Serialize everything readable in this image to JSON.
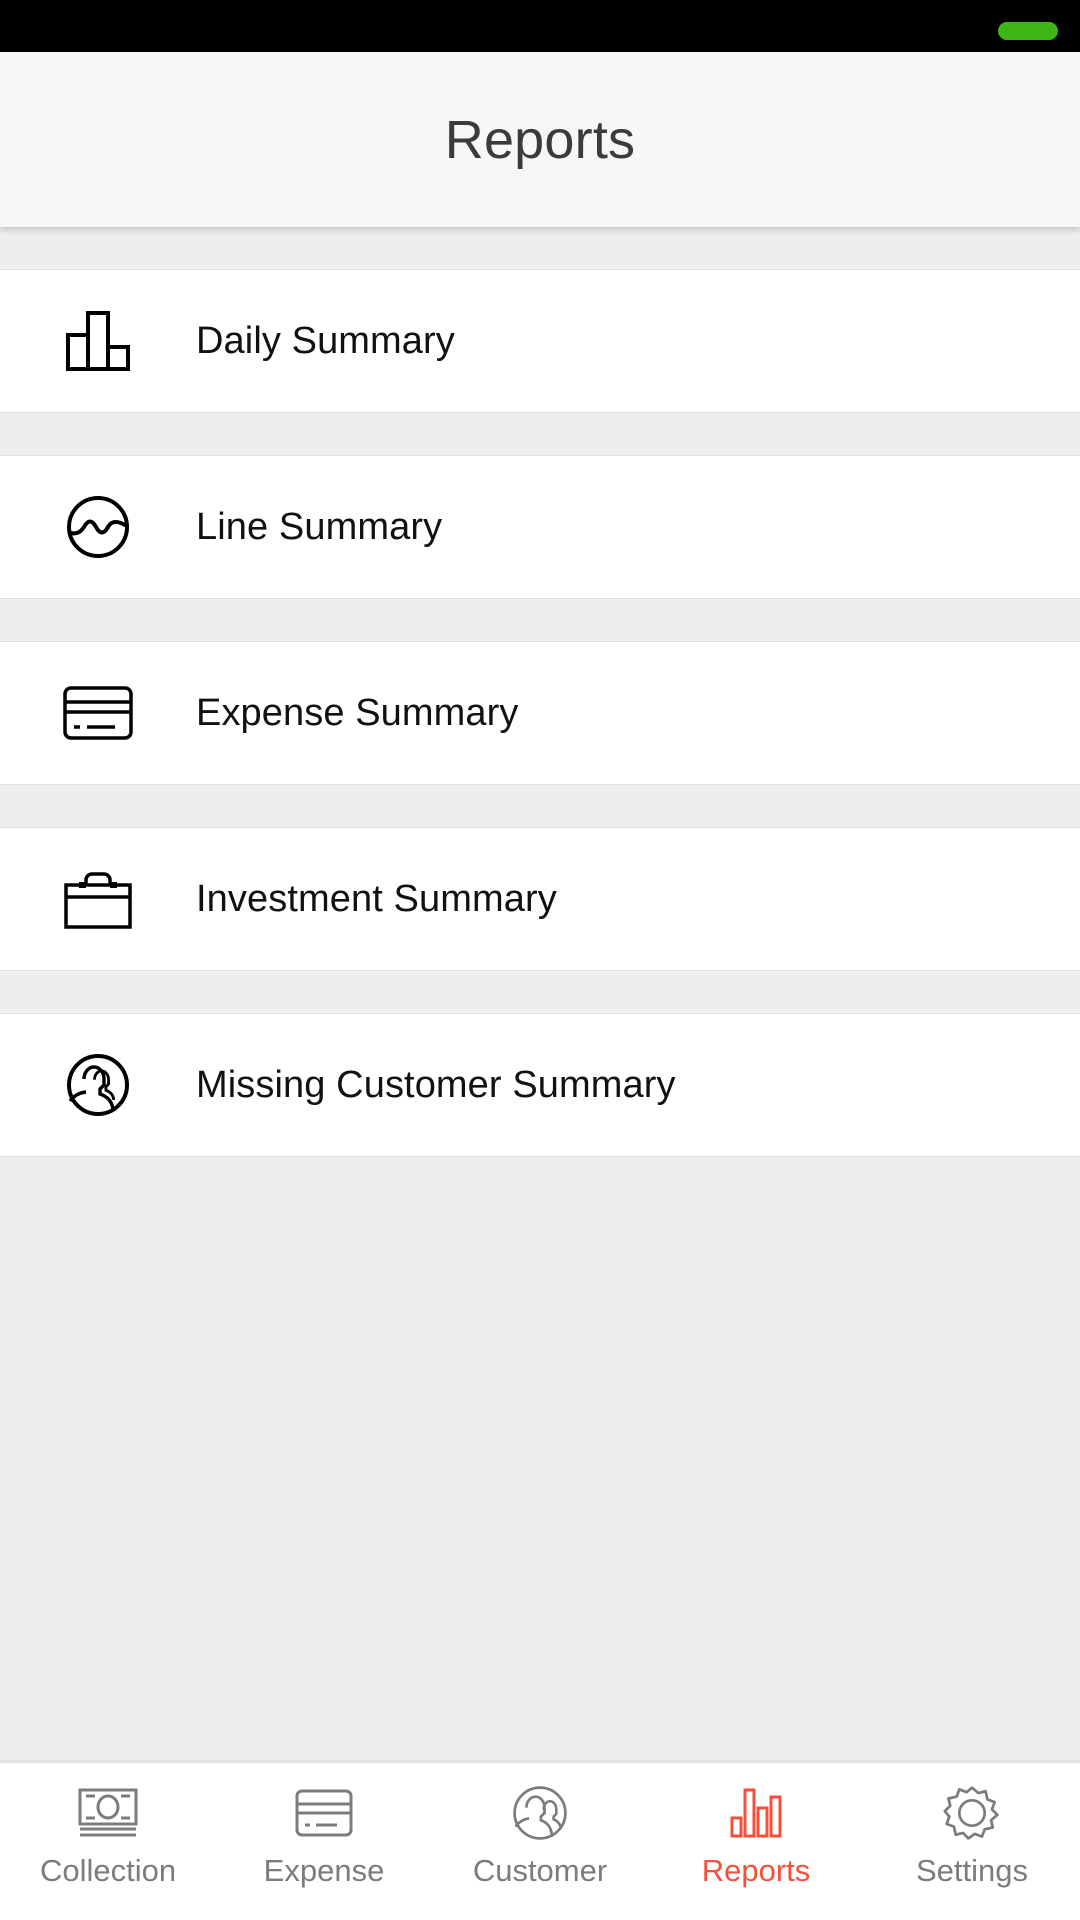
{
  "status_bar": {
    "indicator_name": "battery-pill-indicator",
    "indicator_color": "#3fb618"
  },
  "header": {
    "title": "Reports"
  },
  "colors": {
    "accent": "#f4503c",
    "page_background": "#eeeeee",
    "card_background": "#ffffff",
    "header_background": "#f7f7f7",
    "nav_inactive": "#7c7c7c",
    "text_primary": "#111111"
  },
  "reports_list": {
    "items": [
      {
        "label": "Daily Summary",
        "icon": "bar-chart-icon"
      },
      {
        "label": "Line Summary",
        "icon": "wave-circle-icon"
      },
      {
        "label": "Expense Summary",
        "icon": "credit-card-icon"
      },
      {
        "label": "Investment Summary",
        "icon": "briefcase-icon"
      },
      {
        "label": "Missing Customer Summary",
        "icon": "people-circle-icon"
      }
    ]
  },
  "bottom_nav": {
    "items": [
      {
        "label": "Collection",
        "icon": "banknote-icon",
        "active": false
      },
      {
        "label": "Expense",
        "icon": "credit-card-icon",
        "active": false
      },
      {
        "label": "Customer",
        "icon": "people-circle-icon",
        "active": false
      },
      {
        "label": "Reports",
        "icon": "bar-chart-icon",
        "active": true
      },
      {
        "label": "Settings",
        "icon": "gear-icon",
        "active": false
      }
    ]
  }
}
